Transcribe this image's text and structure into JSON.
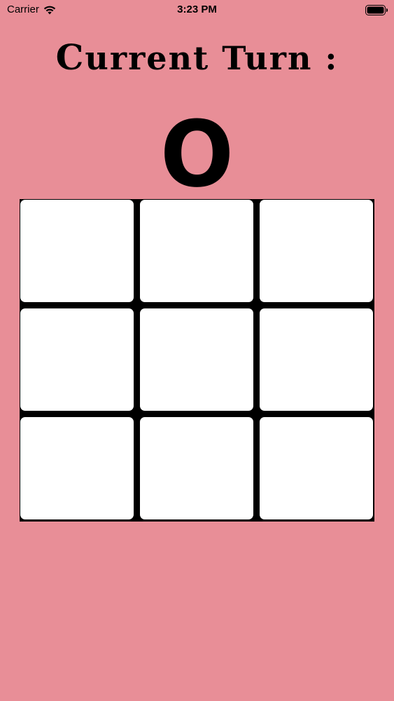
{
  "status_bar": {
    "carrier": "Carrier",
    "time": "3:23 PM",
    "wifi_icon": "wifi-icon",
    "battery_icon": "battery-icon"
  },
  "game": {
    "title_first_letter": "C",
    "title_rest": "urrent Turn :",
    "current_turn": "O",
    "board": [
      "",
      "",
      "",
      "",
      "",
      "",
      "",
      "",
      ""
    ]
  },
  "colors": {
    "background": "#e88e97",
    "board_lines": "#000000",
    "cell": "#ffffff"
  }
}
